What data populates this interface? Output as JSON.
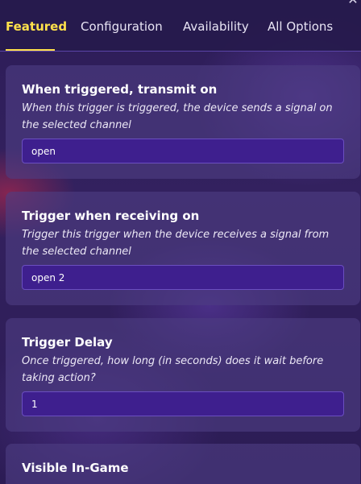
{
  "tabs": [
    {
      "label": "Featured",
      "active": true
    },
    {
      "label": "Configuration",
      "active": false
    },
    {
      "label": "Availability",
      "active": false
    },
    {
      "label": "All Options",
      "active": false
    }
  ],
  "colors": {
    "active_tab": "#ffe14b",
    "input_bg": "#3e1f8e",
    "panel_bg": "#2d1d58"
  },
  "settings": [
    {
      "title": "When triggered, transmit on",
      "description": "When this trigger is triggered, the device sends a signal on the selected channel",
      "value": "open"
    },
    {
      "title": "Trigger when receiving on",
      "description": "Trigger this trigger when the device receives a signal from the selected channel",
      "value": "open 2"
    },
    {
      "title": "Trigger Delay",
      "description": "Once triggered, how long (in seconds) does it wait before taking action?",
      "value": "1"
    },
    {
      "title": "Visible In-Game"
    }
  ]
}
